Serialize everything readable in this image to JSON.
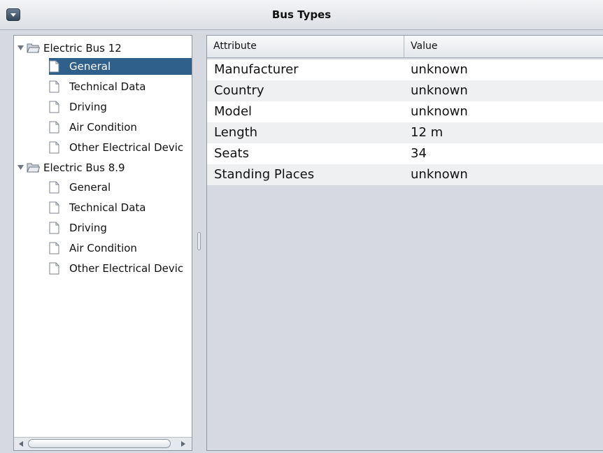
{
  "window": {
    "title": "Bus Types",
    "menu_icon": "chevron-down-icon"
  },
  "tree": {
    "groups": [
      {
        "label": "Electric Bus 12",
        "expanded": true,
        "items": [
          {
            "label": "General",
            "selected": true
          },
          {
            "label": "Technical Data",
            "selected": false
          },
          {
            "label": "Driving",
            "selected": false
          },
          {
            "label": "Air Condition",
            "selected": false
          },
          {
            "label": "Other Electrical Devic",
            "selected": false
          }
        ]
      },
      {
        "label": "Electric Bus 8.9",
        "expanded": true,
        "items": [
          {
            "label": "General",
            "selected": false
          },
          {
            "label": "Technical Data",
            "selected": false
          },
          {
            "label": "Driving",
            "selected": false
          },
          {
            "label": "Air Condition",
            "selected": false
          },
          {
            "label": "Other Electrical Devic",
            "selected": false
          }
        ]
      }
    ]
  },
  "table": {
    "headers": {
      "attribute": "Attribute",
      "value": "Value"
    },
    "rows": [
      {
        "attribute": "Manufacturer",
        "value": "unknown"
      },
      {
        "attribute": "Country",
        "value": "unknown"
      },
      {
        "attribute": "Model",
        "value": "unknown"
      },
      {
        "attribute": "Length",
        "value": "12 m"
      },
      {
        "attribute": "Seats",
        "value": "34"
      },
      {
        "attribute": "Standing Places",
        "value": "unknown"
      }
    ]
  },
  "colors": {
    "selection": "#2f5f8b",
    "background": "#d6d9df"
  }
}
